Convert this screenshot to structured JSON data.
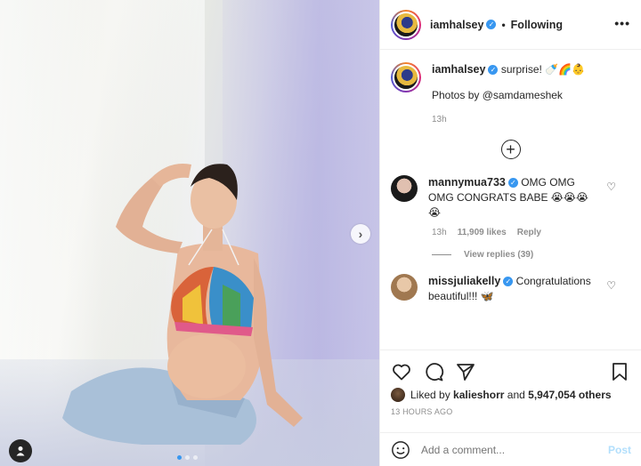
{
  "post": {
    "author": "iamhalsey",
    "follow_sep": "•",
    "follow_label": "Following",
    "more_label": "•••",
    "caption_text": "surprise! 🍼🌈👶",
    "caption_credit": "Photos by @samdameshek",
    "caption_time": "13h"
  },
  "comments": [
    {
      "user": "mannymua733",
      "text": "OMG OMG OMG CONGRATS BABE 😭😭😭😭",
      "time": "13h",
      "likes": "11,909 likes",
      "reply": "Reply",
      "view_replies": "View replies (39)"
    },
    {
      "user": "missjuliakelly",
      "text": "Congratulations beautiful!!! 🦋"
    }
  ],
  "likes": {
    "prefix": "Liked by",
    "user": "kalieshorr",
    "and": "and",
    "count": "5,947,054 others"
  },
  "timestamp": "13 HOURS AGO",
  "add_comment": {
    "placeholder": "Add a comment...",
    "post_label": "Post"
  },
  "carousel": {
    "next_icon": "chevron-right-icon",
    "slide_count": 3,
    "active_slide": 1
  },
  "colors": {
    "verified": "#3897f0",
    "post_disabled": "#b2dffc",
    "muted": "#8e8e8e"
  }
}
